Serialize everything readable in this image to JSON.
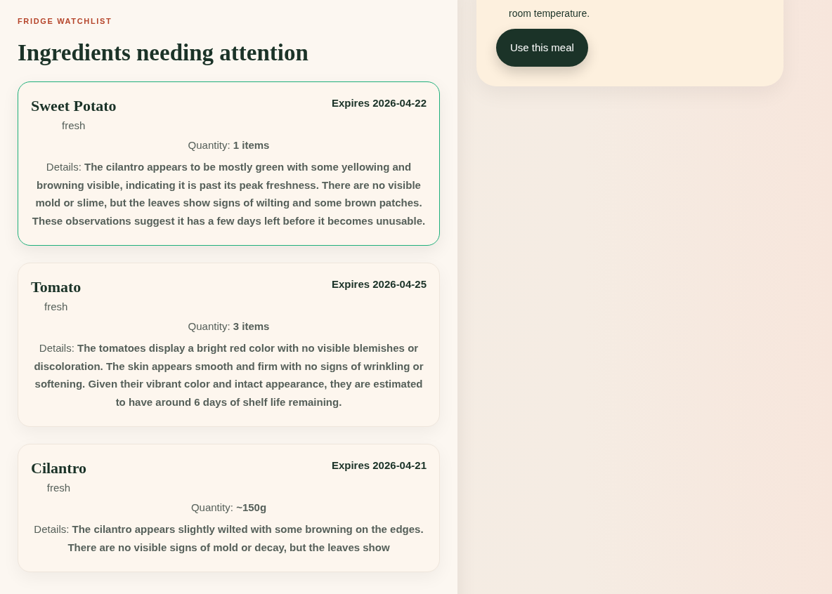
{
  "watchlist": {
    "eyebrow": "FRIDGE WATCHLIST",
    "title": "Ingredients needing attention",
    "items": [
      {
        "name": "Sweet Potato",
        "status": "fresh",
        "expires": "Expires 2026-04-22",
        "quantity": "Quantity: **1 items**",
        "details": "Details: **The cilantro appears to be mostly green with some yellowing and browning visible, indicating it is past its peak freshness. There are no visible mold or slime, but the leaves show signs of wilting and some brown patches. These observations suggest it has a few days left before it becomes unusable.**",
        "selected": true
      },
      {
        "name": "Tomato",
        "status": "fresh",
        "expires": "Expires 2026-04-25",
        "quantity": "Quantity: **3 items**",
        "details": "Details: **The tomatoes display a bright red color with no visible blemishes or discoloration. The skin appears smooth and firm with no signs of wrinkling or softening. Given their vibrant color and intact appearance, they are estimated to have around 6 days of shelf life remaining.**",
        "selected": false
      },
      {
        "name": "Cilantro",
        "status": "fresh",
        "expires": "Expires 2026-04-21",
        "quantity": "Quantity: **~150g**",
        "details": "Details: **The cilantro appears slightly wilted with some browning on the edges. There are no visible signs of mold or decay, but the leaves show**",
        "selected": false
      }
    ]
  },
  "meal": {
    "text": "room temperature.",
    "button": "Use this meal"
  }
}
